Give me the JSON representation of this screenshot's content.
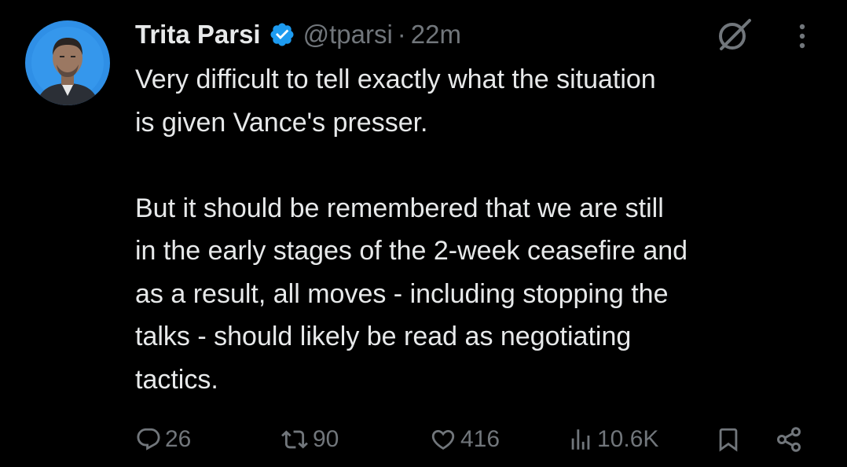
{
  "author": {
    "display_name": "Trita Parsi",
    "handle": "@tparsi",
    "separator": "·",
    "time": "22m",
    "verified": true,
    "verified_color": "#1d9bf0",
    "avatar_background": "#2f8fe6"
  },
  "tweet": {
    "paragraph_1": [
      "Very difficult to tell exactly what the situation",
      "is given Vance's presser."
    ],
    "paragraph_2": [
      "But it should be remembered that we are still",
      "in the early stages of the 2-week ceasefire and",
      "as a result, all moves - including stopping the",
      "talks - should likely be read as negotiating",
      "tactics."
    ]
  },
  "actions": {
    "reply": {
      "icon": "reply-icon",
      "count": "26"
    },
    "retweet": {
      "icon": "retweet-icon",
      "count": "90"
    },
    "like": {
      "icon": "heart-icon",
      "count": "416"
    },
    "views": {
      "icon": "views-icon",
      "count": "10.6K"
    },
    "bookmark": {
      "icon": "bookmark-icon"
    },
    "share": {
      "icon": "share-icon"
    }
  },
  "header_icons": {
    "grok": "grok-icon",
    "more": "more-icon"
  },
  "colors": {
    "background": "#000000",
    "text": "#e7e9ea",
    "secondary": "#71767b",
    "verified": "#1d9bf0"
  }
}
